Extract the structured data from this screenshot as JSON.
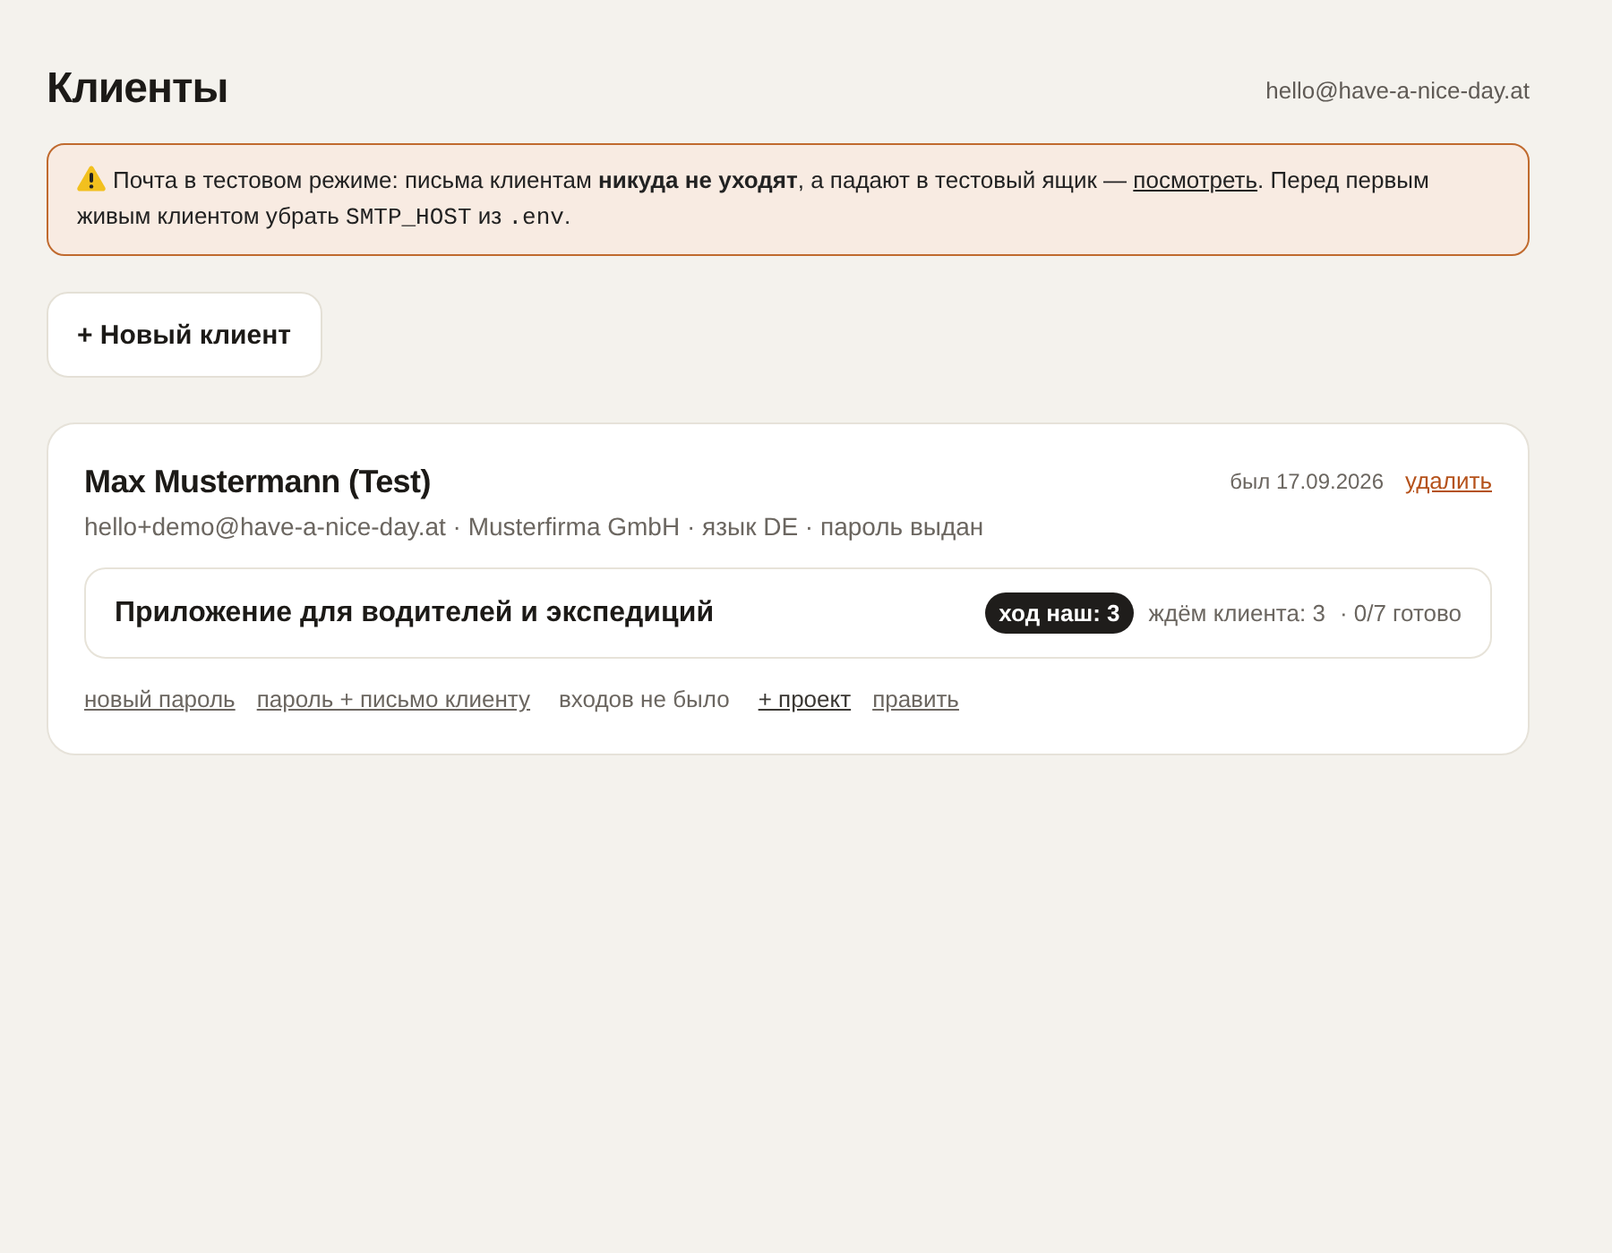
{
  "header": {
    "title": "Клиенты",
    "account": "hello@have-a-nice-day.at"
  },
  "notice": {
    "parts": [
      {
        "kind": "text",
        "text": "Почта в тестовом режиме: письма клиентам **никуда не уходят**, а падают в тестовый ящик — "
      },
      {
        "kind": "link",
        "text": "посмотреть"
      },
      {
        "kind": "text",
        "text": ". Перед первым живым клиентом убрать "
      },
      {
        "kind": "code",
        "text": "SMTP_HOST"
      },
      {
        "kind": "text",
        "text": " из "
      },
      {
        "kind": "code",
        "text": ".env"
      },
      {
        "kind": "text",
        "text": "."
      }
    ]
  },
  "new_client_button": {
    "label": "+ Новый клиент"
  },
  "clients": [
    {
      "name": "Max Mustermann (Test)",
      "details": "hello+demo@have-a-nice-day.at · Musterfirma GmbH · язык DE · пароль выдан",
      "last_seen": "был 17.09.2026",
      "delete_link": "удалить",
      "projects": [
        {
          "title": "Приложение для водителей и экспедиций",
          "badge": "ход наш: 3",
          "waiting": "ждём клиента: 3",
          "progress": "· 0/7 готово"
        }
      ],
      "actions": [
        {
          "kind": "link",
          "label": "новый пароль"
        },
        {
          "kind": "link",
          "label": "пароль + письмо клиенту"
        },
        {
          "kind": "text",
          "label": "входов не было"
        },
        {
          "kind": "primary-link",
          "label": "+ проект"
        },
        {
          "kind": "link",
          "label": "править"
        }
      ]
    }
  ]
}
